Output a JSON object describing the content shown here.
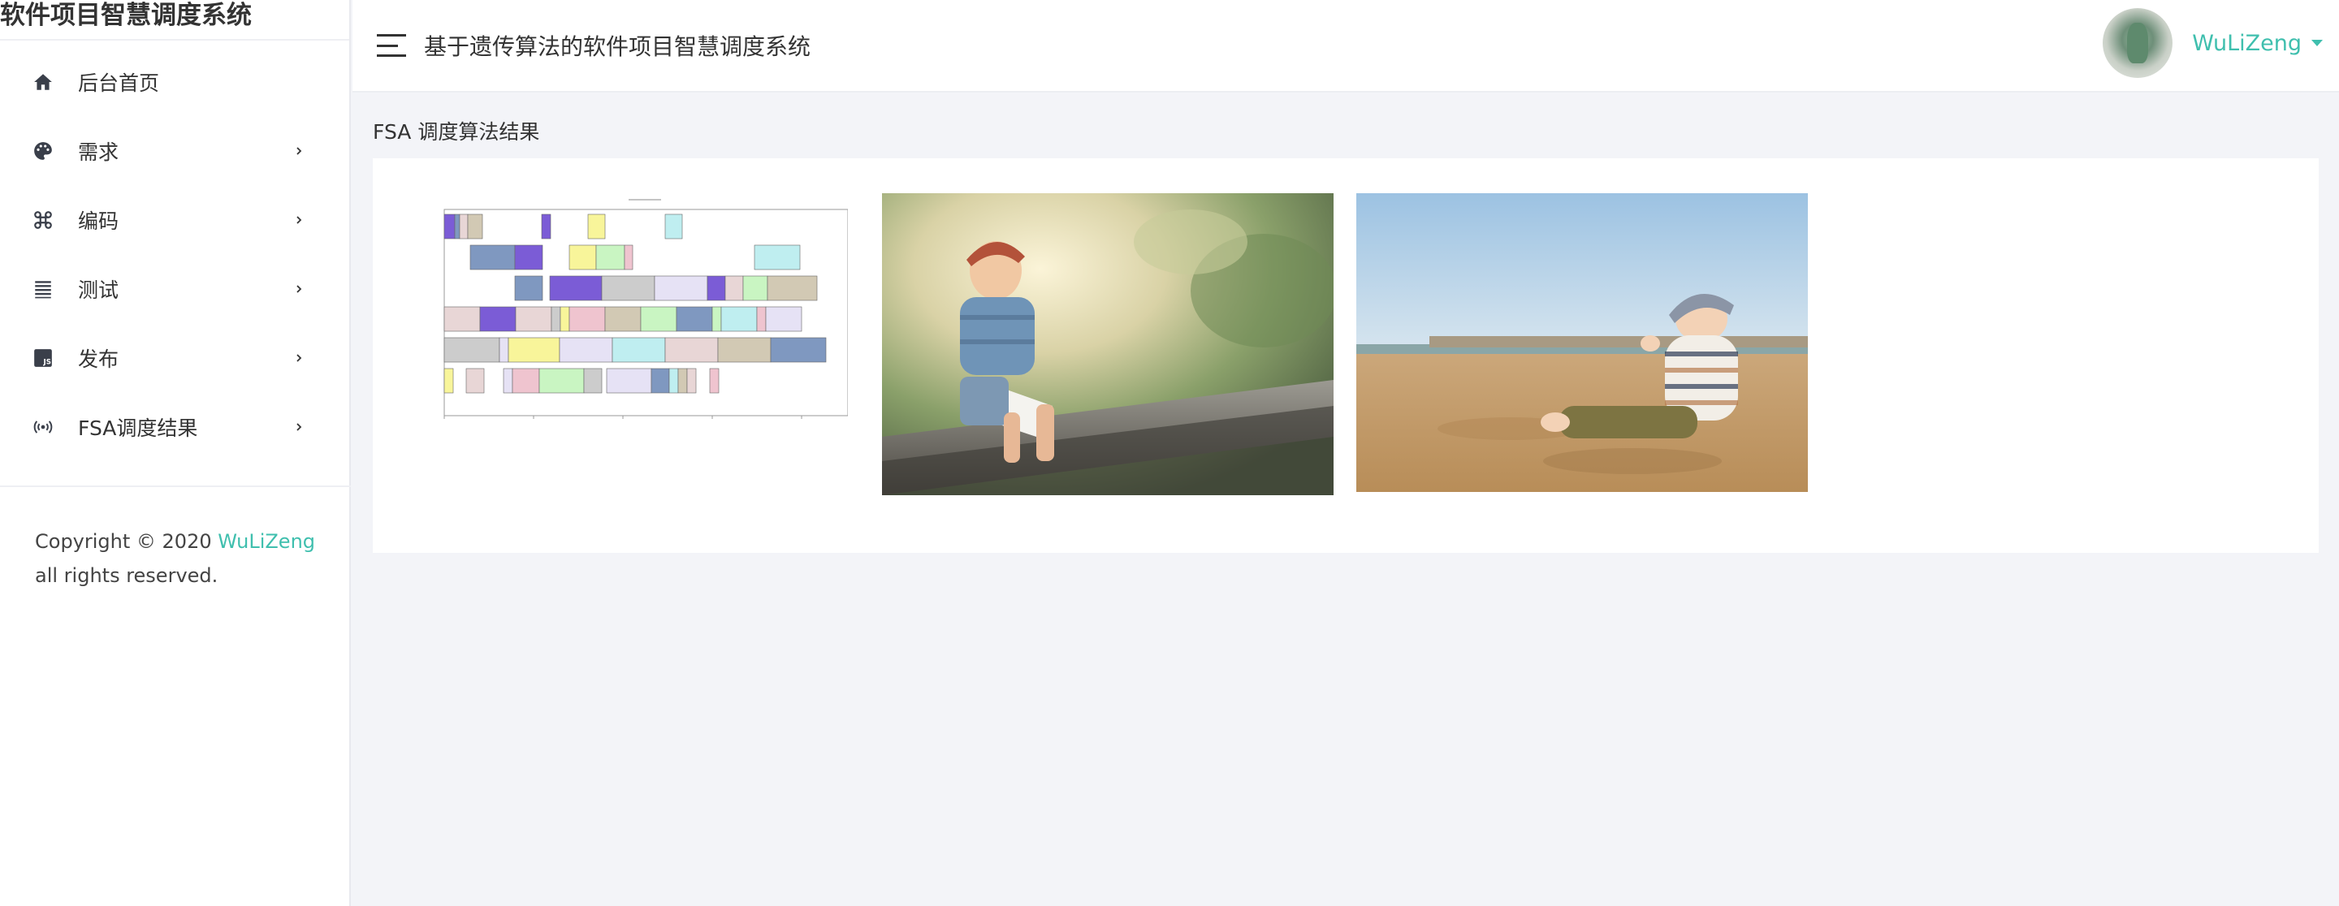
{
  "sidebar": {
    "brand": "软件项目智慧调度系统",
    "items": [
      {
        "label": "后台首页",
        "icon": "home-icon",
        "has_submenu": false
      },
      {
        "label": "需求",
        "icon": "palette-icon",
        "has_submenu": true
      },
      {
        "label": "编码",
        "icon": "command-icon",
        "has_submenu": true
      },
      {
        "label": "测试",
        "icon": "list-icon",
        "has_submenu": true
      },
      {
        "label": "发布",
        "icon": "js-icon",
        "has_submenu": true
      },
      {
        "label": "FSA调度结果",
        "icon": "broadcast-icon",
        "has_submenu": true
      }
    ],
    "copyright": {
      "prefix": "Copyright © 2020 ",
      "author": "WuLiZeng",
      "suffix": "all rights reserved."
    }
  },
  "header": {
    "title": "基于遗传算法的软件项目智慧调度系统",
    "user_name": "WuLiZeng"
  },
  "main": {
    "page_title": "FSA 调度算法结果",
    "images": [
      {
        "name": "gantt-chart-image",
        "kind": "scheduling gantt chart"
      },
      {
        "name": "boy-on-bench-photo",
        "kind": "photo"
      },
      {
        "name": "baby-on-beach-photo",
        "kind": "photo"
      }
    ]
  },
  "colors": {
    "accent": "#3fbfae",
    "background": "#f3f4f8",
    "text": "#333333"
  }
}
